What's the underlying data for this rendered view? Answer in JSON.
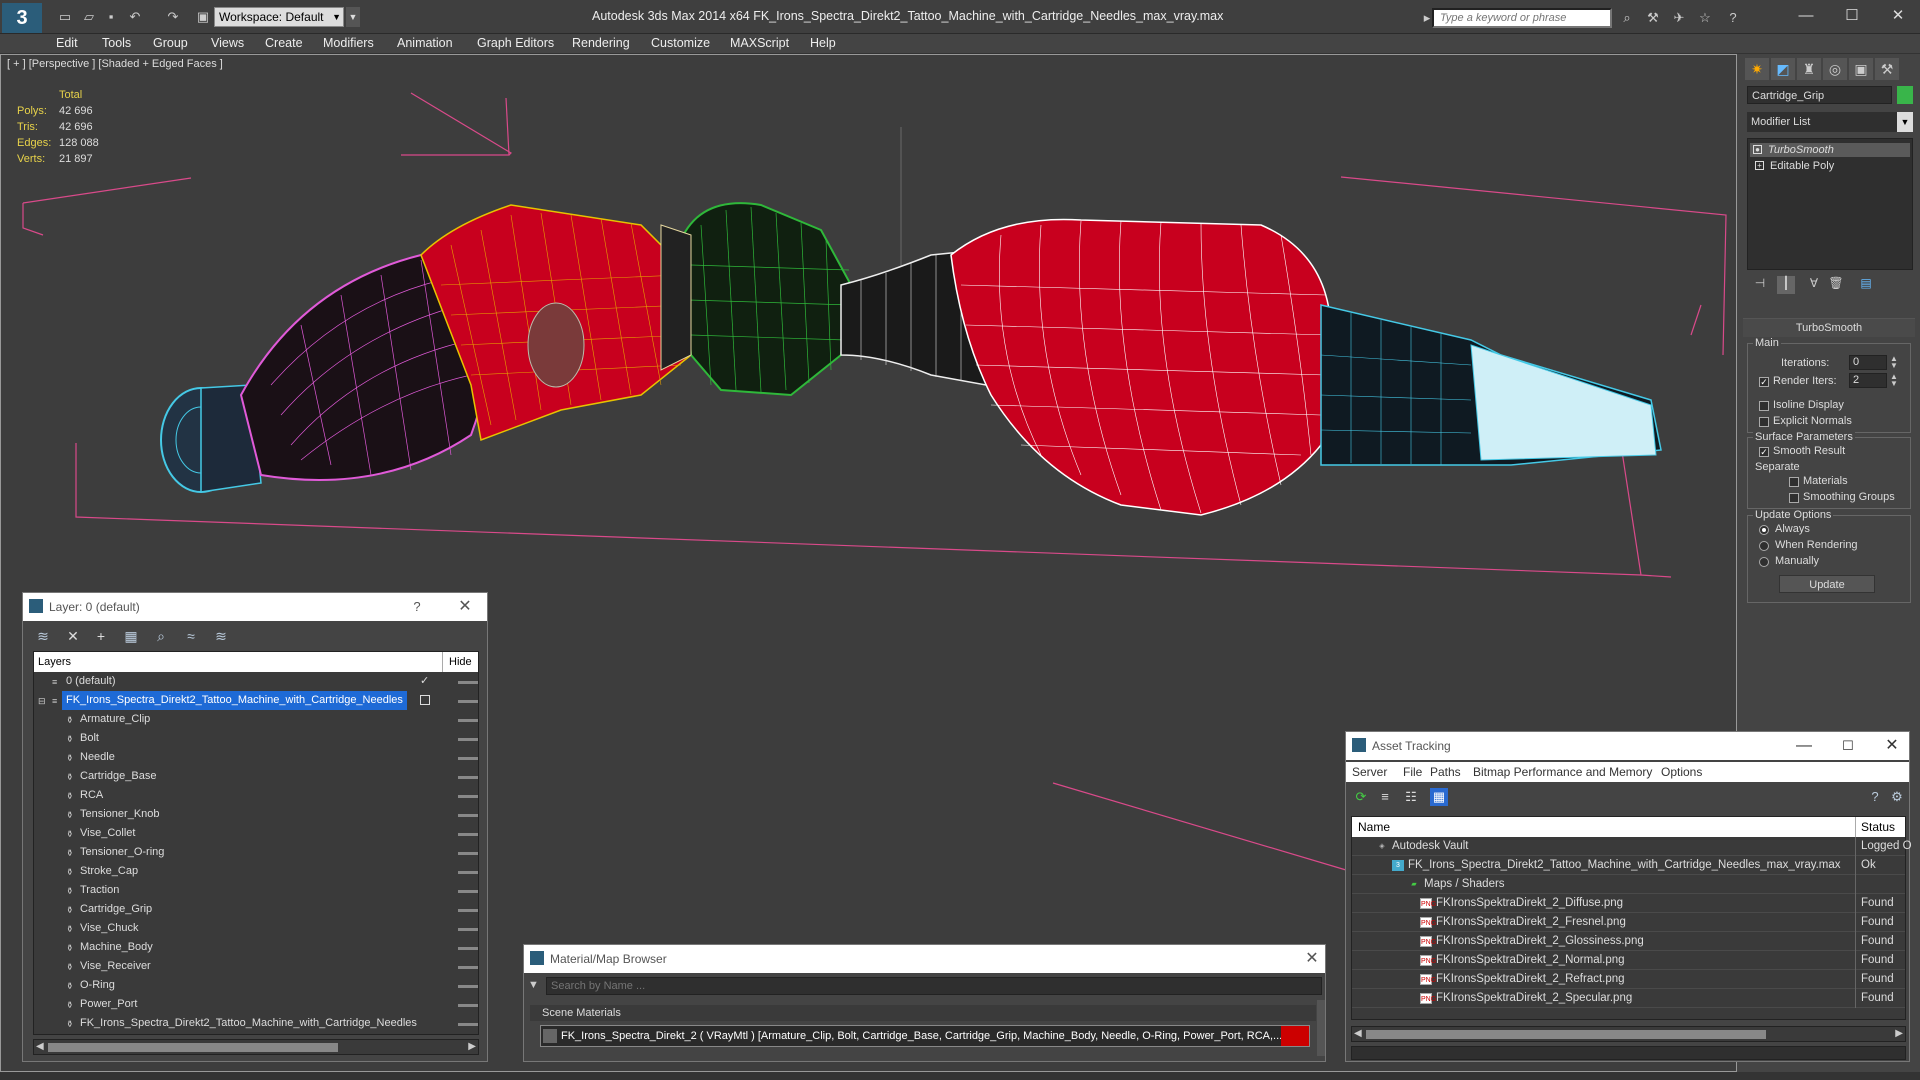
{
  "app": {
    "title": "Autodesk 3ds Max  2014 x64     FK_Irons_Spectra_Direkt2_Tattoo_Machine_with_Cartridge_Needles_max_vray.max",
    "logo": "3",
    "workspace": "Workspace: Default",
    "search_placeholder": "Type a keyword or phrase",
    "window_controls": [
      "—",
      "☐",
      "✕"
    ]
  },
  "menu": [
    "Edit",
    "Tools",
    "Group",
    "Views",
    "Create",
    "Modifiers",
    "Animation",
    "Graph Editors",
    "Rendering",
    "Customize",
    "MAXScript",
    "Help"
  ],
  "viewport": {
    "label": "[ + ] [Perspective ] [Shaded + Edged Faces ]",
    "stats": {
      "header": "Total",
      "rows": [
        {
          "key": "Polys:",
          "value": "42 696"
        },
        {
          "key": "Tris:",
          "value": "42 696"
        },
        {
          "key": "Edges:",
          "value": "128 088"
        },
        {
          "key": "Verts:",
          "value": "21 897"
        }
      ]
    },
    "colors": {
      "pink_wire": "#e05ad8",
      "red_body": "#c8001e",
      "green_wire": "#2fb83a",
      "cyan_wire": "#45c9e6",
      "bbox": "#d94a8a"
    }
  },
  "command_panel": {
    "object_name": "Cartridge_Grip",
    "object_color": "#39b54a",
    "modifier_list_label": "Modifier List",
    "stack": [
      "TurboSmooth",
      "Editable Poly"
    ],
    "rollout_title": "TurboSmooth",
    "main_label": "Main",
    "iterations_label": "Iterations:",
    "iterations_value": "0",
    "render_iters_label": "Render Iters:",
    "render_iters_value": "2",
    "isoline_label": "Isoline Display",
    "explicit_normals_label": "Explicit Normals",
    "surface_params_label": "Surface Parameters",
    "smooth_result_label": "Smooth Result",
    "separate_label": "Separate",
    "materials_label": "Materials",
    "smoothing_groups_label": "Smoothing Groups",
    "update_options_label": "Update Options",
    "always_label": "Always",
    "when_rendering_label": "When Rendering",
    "manually_label": "Manually",
    "update_button": "Update"
  },
  "layers_panel": {
    "title": "Layer: 0 (default)",
    "help": "?",
    "close": "✕",
    "col_layers": "Layers",
    "col_hide": "Hide",
    "rows": [
      {
        "name": "0 (default)",
        "level": 0,
        "kind": "layer"
      },
      {
        "name": "FK_Irons_Spectra_Direkt2_Tattoo_Machine_with_Cartridge_Needles",
        "level": 0,
        "kind": "layer"
      },
      {
        "name": "Armature_Clip",
        "level": 1,
        "kind": "object"
      },
      {
        "name": "Bolt",
        "level": 1,
        "kind": "object"
      },
      {
        "name": "Needle",
        "level": 1,
        "kind": "object"
      },
      {
        "name": "Cartridge_Base",
        "level": 1,
        "kind": "object"
      },
      {
        "name": "RCA",
        "level": 1,
        "kind": "object"
      },
      {
        "name": "Tensioner_Knob",
        "level": 1,
        "kind": "object"
      },
      {
        "name": "Vise_Collet",
        "level": 1,
        "kind": "object"
      },
      {
        "name": "Tensioner_O-ring",
        "level": 1,
        "kind": "object"
      },
      {
        "name": "Stroke_Cap",
        "level": 1,
        "kind": "object"
      },
      {
        "name": "Traction",
        "level": 1,
        "kind": "object"
      },
      {
        "name": "Cartridge_Grip",
        "level": 1,
        "kind": "object"
      },
      {
        "name": "Vise_Chuck",
        "level": 1,
        "kind": "object"
      },
      {
        "name": "Machine_Body",
        "level": 1,
        "kind": "object"
      },
      {
        "name": "Vise_Receiver",
        "level": 1,
        "kind": "object"
      },
      {
        "name": "O-Ring",
        "level": 1,
        "kind": "object"
      },
      {
        "name": "Power_Port",
        "level": 1,
        "kind": "object"
      },
      {
        "name": "FK_Irons_Spectra_Direkt2_Tattoo_Machine_with_Cartridge_Needles",
        "level": 1,
        "kind": "object"
      }
    ]
  },
  "material_browser": {
    "title": "Material/Map Browser",
    "close": "✕",
    "search_placeholder": "Search by Name ...",
    "category": "Scene Materials",
    "item": "FK_Irons_Spectra_Direkt_2  ( VRayMtl ) [Armature_Clip, Bolt, Cartridge_Base, Cartridge_Grip, Machine_Body, Needle, O-Ring, Power_Port, RCA,..."
  },
  "asset_tracking": {
    "title": "Asset Tracking",
    "window_controls": [
      "—",
      "☐",
      "✕"
    ],
    "menu": [
      "Server",
      "File",
      "Paths",
      "Bitmap Performance and Memory",
      "Options"
    ],
    "col_name": "Name",
    "col_status": "Status",
    "rows": [
      {
        "name": "Autodesk Vault",
        "status": "Logged O",
        "level": 0,
        "icon": "vault"
      },
      {
        "name": "FK_Irons_Spectra_Direkt2_Tattoo_Machine_with_Cartridge_Needles_max_vray.max",
        "status": "Ok",
        "level": 1,
        "icon": "max"
      },
      {
        "name": "Maps / Shaders",
        "status": "",
        "level": 2,
        "icon": "folder"
      },
      {
        "name": "FKIronsSpektraDirekt_2_Diffuse.png",
        "status": "Found",
        "level": 3,
        "icon": "png"
      },
      {
        "name": "FKIronsSpektraDirekt_2_Fresnel.png",
        "status": "Found",
        "level": 3,
        "icon": "png"
      },
      {
        "name": "FKIronsSpektraDirekt_2_Glossiness.png",
        "status": "Found",
        "level": 3,
        "icon": "png"
      },
      {
        "name": "FKIronsSpektraDirekt_2_Normal.png",
        "status": "Found",
        "level": 3,
        "icon": "png"
      },
      {
        "name": "FKIronsSpektraDirekt_2_Refract.png",
        "status": "Found",
        "level": 3,
        "icon": "png"
      },
      {
        "name": "FKIronsSpektraDirekt_2_Specular.png",
        "status": "Found",
        "level": 3,
        "icon": "png"
      }
    ]
  }
}
